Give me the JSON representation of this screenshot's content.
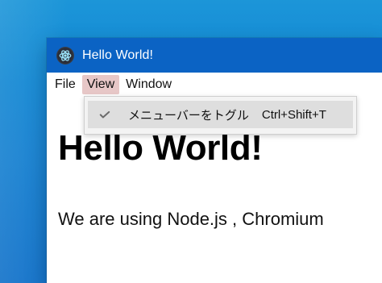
{
  "window": {
    "title": "Hello World!"
  },
  "menubar": {
    "items": [
      {
        "label": "File",
        "active": false
      },
      {
        "label": "View",
        "active": true
      },
      {
        "label": "Window",
        "active": false
      }
    ]
  },
  "dropdown": {
    "item": {
      "checked": true,
      "label": "メニューバーをトグル",
      "accelerator": "Ctrl+Shift+T"
    }
  },
  "content": {
    "heading": "Hello World!",
    "paragraph": "We are using Node.js , Chromium"
  },
  "icons": {
    "app": "electron-atom-icon",
    "check": "check-icon"
  },
  "colors": {
    "desktop_blue": "#137fd0",
    "titlebar_blue": "#0b63c4",
    "menu_active_bg": "#e7c7c7",
    "dropdown_bg": "#f3f3f3",
    "dropdown_item_bg": "#dedede"
  }
}
